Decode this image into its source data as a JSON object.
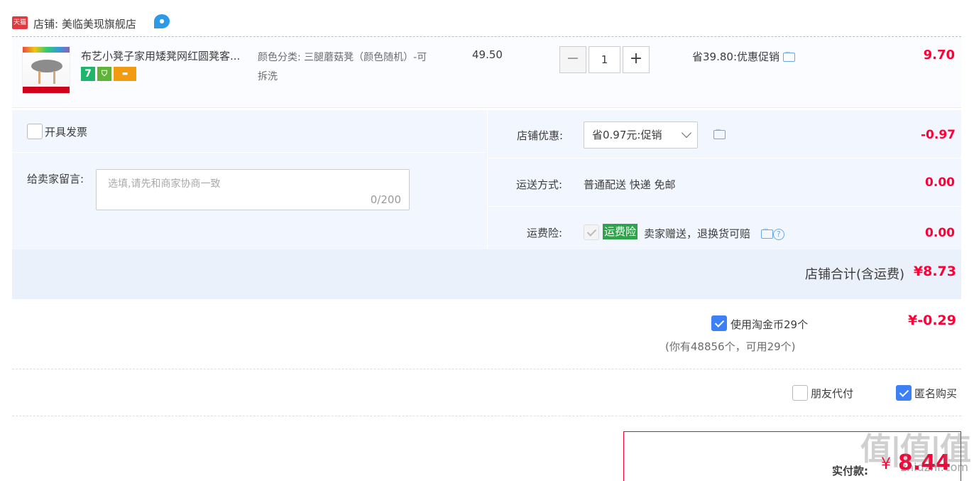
{
  "shop": {
    "badge": "天猫",
    "name": "店铺: 美临美现旗舰店"
  },
  "item": {
    "title": "布艺小凳子家用矮凳网红圆凳客...",
    "sku": "颜色分类: 三腿蘑菇凳（颜色随机）-可拆洗",
    "unit_price": "49.50",
    "quantity": "1",
    "minus": "−",
    "plus": "+",
    "promo": "省39.80:优惠促销",
    "total": "9.70",
    "service_icons": [
      "seven-day-return-icon",
      "insurance-icon",
      "card-icon"
    ],
    "seven_label": "7"
  },
  "invoice": {
    "label": "开具发票",
    "checked": false
  },
  "message": {
    "label": "给卖家留言:",
    "placeholder": "选填,请先和商家协商一致",
    "count": "0/200"
  },
  "discount": {
    "label": "店铺优惠:",
    "selected": "省0.97元:促销",
    "amount": "-0.97"
  },
  "shipping": {
    "label": "运送方式:",
    "method": "普通配送 快递 免邮",
    "amount": "0.00"
  },
  "insurance": {
    "label": "运费险:",
    "tag": "运费险",
    "text": "卖家赠送，退换货可赔",
    "amount": "0.00"
  },
  "shop_total": {
    "label": "店铺合计(含运费)",
    "value": "¥8.73"
  },
  "coins": {
    "label": "使用淘金币29个",
    "note": "(你有48856个，可用29个)",
    "amount": "¥-0.29",
    "checked": true
  },
  "options": {
    "friend_pay": "朋友代付",
    "anonymous": "匿名购买",
    "anonymous_checked": true
  },
  "payment": {
    "label": "实付款:",
    "currency": "¥",
    "value": "8.44"
  },
  "watermark": {
    "text": "值|值|值",
    "url": "zhidzhi.com"
  },
  "colors": {
    "price_red": "#ff0036",
    "checkbox_blue": "#3d7ff5",
    "panel_bg": "#f2f7ff",
    "tag_green": "#2fa24b"
  }
}
